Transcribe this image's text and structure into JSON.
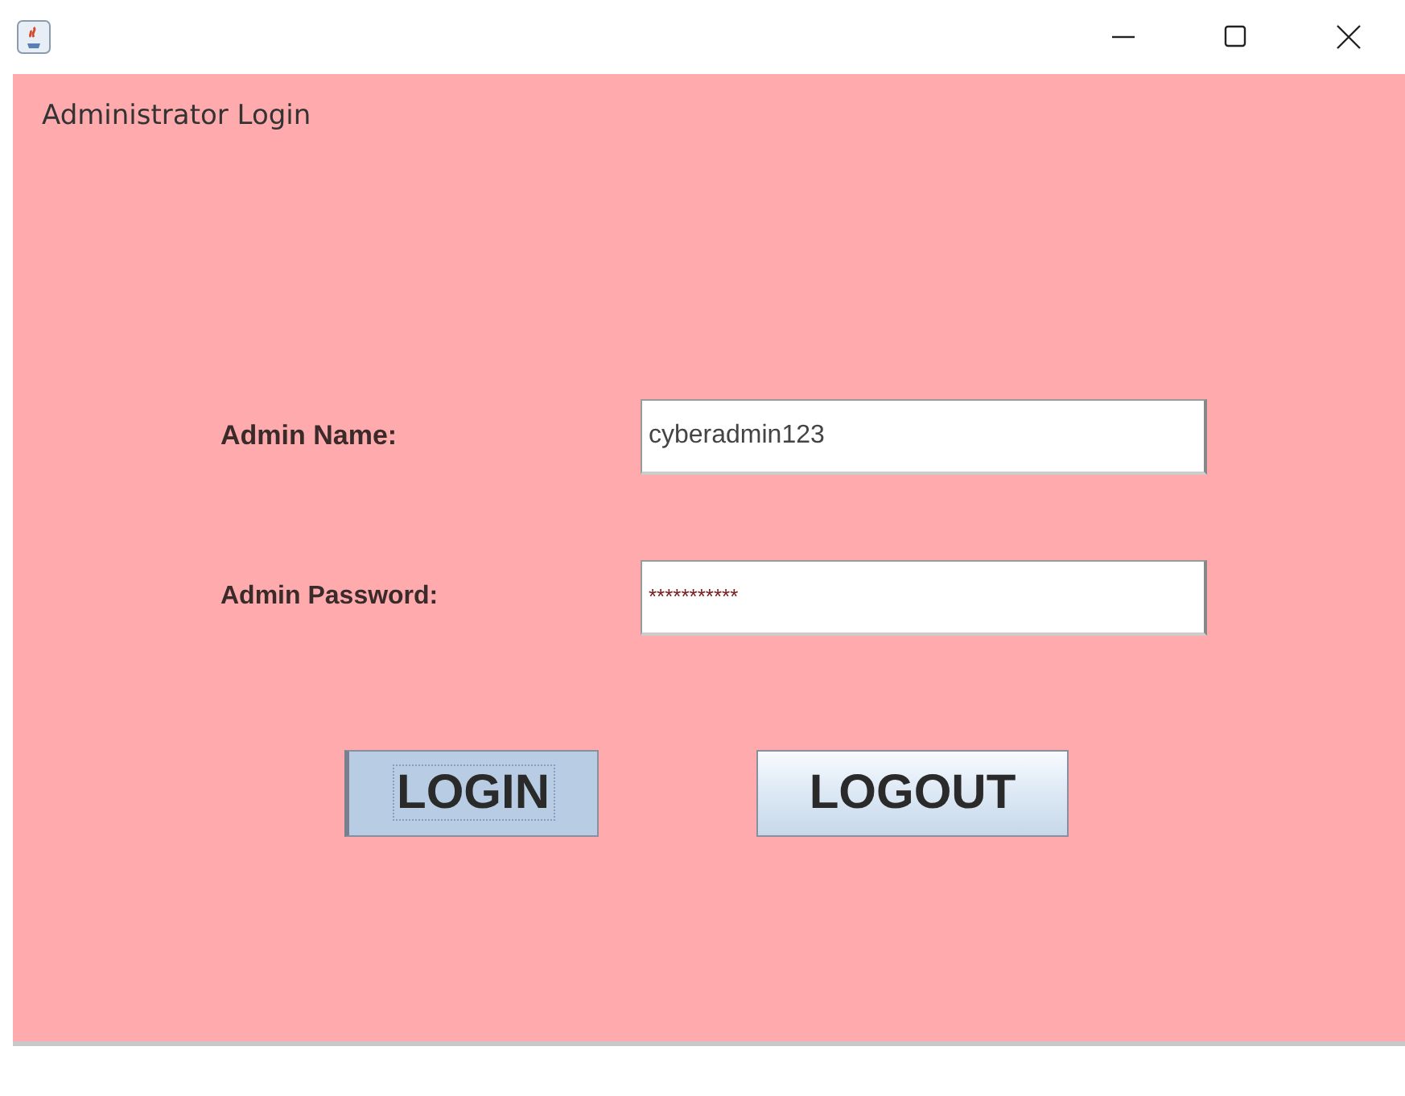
{
  "window": {
    "controls": [
      {
        "kind": "minimize"
      },
      {
        "kind": "maximize"
      },
      {
        "kind": "close"
      }
    ]
  },
  "panel": {
    "title": "Administrator Login"
  },
  "fields": [
    {
      "label": "Admin Name:",
      "kind": "text",
      "value": "cyberadmin123"
    },
    {
      "label": "Admin Password:",
      "kind": "password",
      "value": "***********"
    }
  ],
  "buttons": [
    {
      "label": "LOGIN",
      "focused": true
    },
    {
      "label": "LOGOUT",
      "focused": false
    }
  ]
}
